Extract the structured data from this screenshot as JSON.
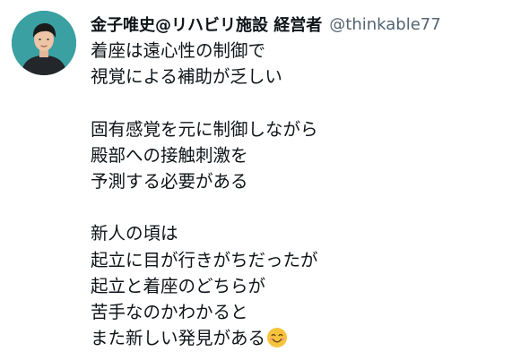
{
  "tweet": {
    "display_name": "金子唯史@リハビリ施設 経営者",
    "handle": "@thinkable77",
    "lines": [
      "着座は遠心性の制御で",
      "視覚による補助が乏しい",
      "",
      "固有感覚を元に制御しながら",
      "殿部への接触刺激を",
      "予測する必要がある",
      "",
      "新人の頃は",
      "起立に目が行きがちだったが",
      "起立と着座のどちらが",
      "苦手なのかわかると",
      "また新しい発見がある"
    ],
    "trailing_emoji": "smiling-face-with-smiling-eyes"
  },
  "colors": {
    "avatar_bg": "#3aa0a2",
    "name_text": "#0f1419",
    "handle_text": "#536471",
    "emoji_face": "#f7c33c",
    "emoji_cheek": "#f19a84"
  }
}
